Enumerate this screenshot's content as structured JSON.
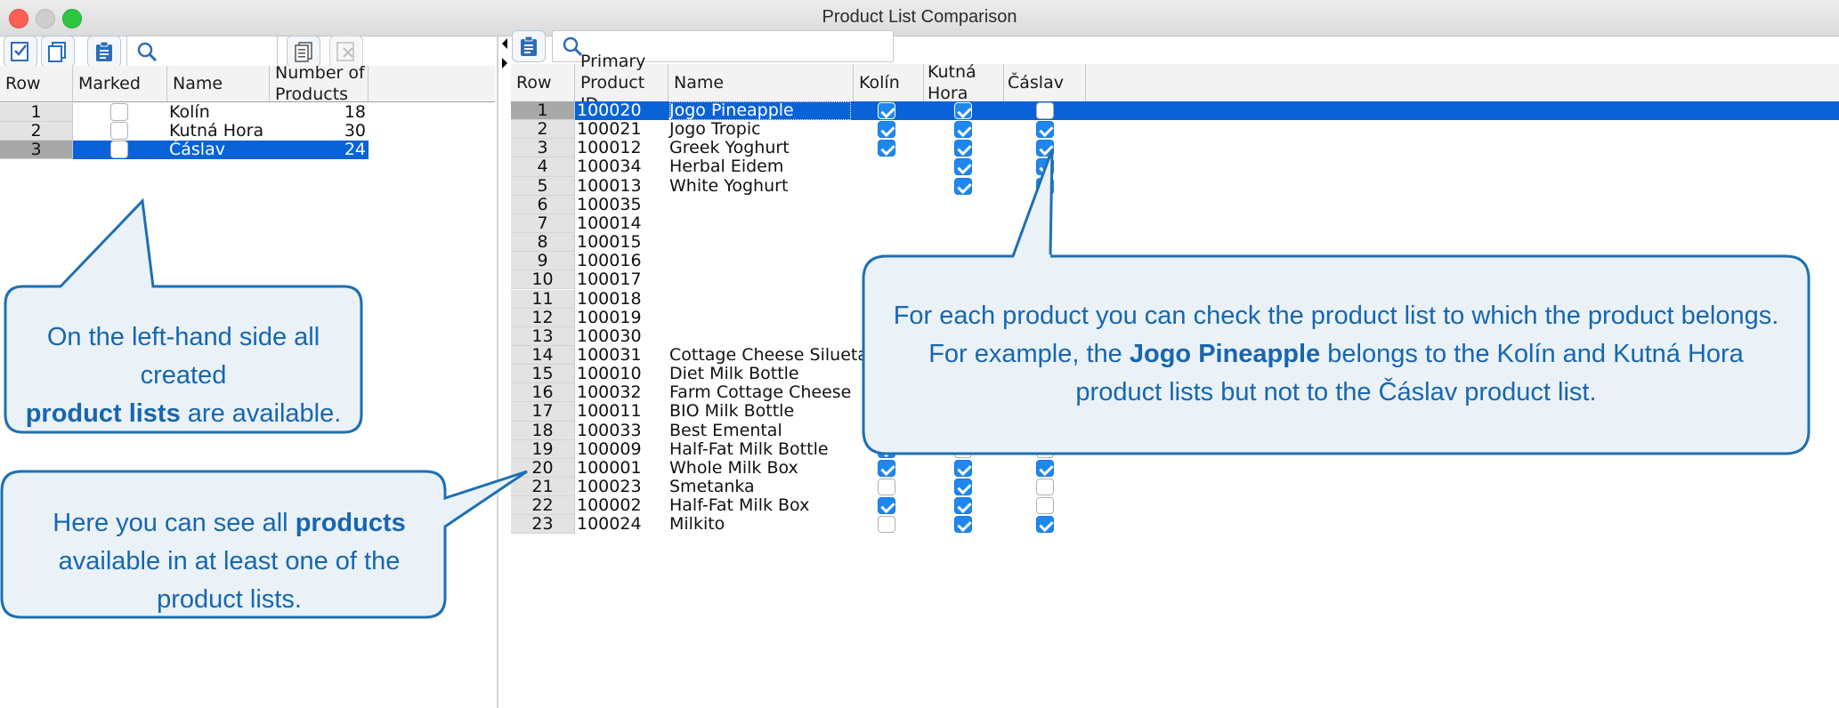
{
  "window": {
    "title": "Product List Comparison"
  },
  "left_panel": {
    "columns": [
      "Row",
      "Marked",
      "Name",
      "Number of Products"
    ],
    "rows": [
      {
        "row": "1",
        "marked": false,
        "name": "Kolín",
        "count": "18",
        "selected": false
      },
      {
        "row": "2",
        "marked": false,
        "name": "Kutná Hora",
        "count": "30",
        "selected": false
      },
      {
        "row": "3",
        "marked": false,
        "name": "Čáslav",
        "count": "24",
        "selected": true
      }
    ]
  },
  "right_panel": {
    "columns": [
      "Row",
      "Primary Product ID",
      "Name",
      "Kolín",
      "Kutná Hora",
      "Čáslav"
    ],
    "rows": [
      {
        "row": "1",
        "id": "100020",
        "name": "Jogo Pineapple",
        "kolin": true,
        "kutna": true,
        "caslav": false,
        "selected": true
      },
      {
        "row": "2",
        "id": "100021",
        "name": "Jogo Tropic",
        "kolin": true,
        "kutna": true,
        "caslav": true
      },
      {
        "row": "3",
        "id": "100012",
        "name": "Greek Yoghurt",
        "kolin": true,
        "kutna": true,
        "caslav": true
      },
      {
        "row": "4",
        "id": "100034",
        "name": "Herbal Eidem",
        "kolin": null,
        "kutna": true,
        "caslav": true
      },
      {
        "row": "5",
        "id": "100013",
        "name": "White Yoghurt",
        "kolin": null,
        "kutna": true,
        "caslav": true
      },
      {
        "row": "6",
        "id": "100035",
        "name": "",
        "kolin": null,
        "kutna": null,
        "caslav": null
      },
      {
        "row": "7",
        "id": "100014",
        "name": "",
        "kolin": null,
        "kutna": null,
        "caslav": null
      },
      {
        "row": "8",
        "id": "100015",
        "name": "",
        "kolin": null,
        "kutna": null,
        "caslav": null
      },
      {
        "row": "9",
        "id": "100016",
        "name": "",
        "kolin": null,
        "kutna": null,
        "caslav": null
      },
      {
        "row": "10",
        "id": "100017",
        "name": "",
        "kolin": null,
        "kutna": null,
        "caslav": null
      },
      {
        "row": "11",
        "id": "100018",
        "name": "",
        "kolin": null,
        "kutna": null,
        "caslav": null
      },
      {
        "row": "12",
        "id": "100019",
        "name": "",
        "kolin": null,
        "kutna": null,
        "caslav": null
      },
      {
        "row": "13",
        "id": "100030",
        "name": "",
        "kolin": null,
        "kutna": null,
        "caslav": null
      },
      {
        "row": "14",
        "id": "100031",
        "name": "Cottage Cheese Silueta",
        "kolin": false,
        "kutna": true,
        "caslav": true
      },
      {
        "row": "15",
        "id": "100010",
        "name": "Diet Milk Bottle",
        "kolin": true,
        "kutna": false,
        "caslav": false
      },
      {
        "row": "16",
        "id": "100032",
        "name": "Farm Cottage Cheese",
        "kolin": false,
        "kutna": true,
        "caslav": true
      },
      {
        "row": "17",
        "id": "100011",
        "name": "BIO Milk Bottle",
        "kolin": true,
        "kutna": false,
        "caslav": false
      },
      {
        "row": "18",
        "id": "100033",
        "name": "Best Emental",
        "kolin": false,
        "kutna": true,
        "caslav": true
      },
      {
        "row": "19",
        "id": "100009",
        "name": "Half-Fat Milk Bottle",
        "kolin": true,
        "kutna": false,
        "caslav": false
      },
      {
        "row": "20",
        "id": "100001",
        "name": "Whole Milk Box",
        "kolin": true,
        "kutna": true,
        "caslav": true
      },
      {
        "row": "21",
        "id": "100023",
        "name": "Smetanka",
        "kolin": false,
        "kutna": true,
        "caslav": false
      },
      {
        "row": "22",
        "id": "100002",
        "name": "Half-Fat Milk Box",
        "kolin": true,
        "kutna": true,
        "caslav": false
      },
      {
        "row": "23",
        "id": "100024",
        "name": "Milkito",
        "kolin": false,
        "kutna": true,
        "caslav": true
      }
    ]
  },
  "callouts": {
    "left_lists": {
      "pre": "On the left-hand side all created",
      "bold": "product lists",
      "post": "are available."
    },
    "products": {
      "pre": "Here you can see all",
      "bold": "products",
      "post": "available in at least one of the product lists."
    },
    "membership": {
      "pre": "For each product you can check the product list to which the product belongs. For example, the",
      "bold": "Jogo Pineapple",
      "post": "belongs to the Kolín and Kutná Hora product lists but not to the Čáslav product list."
    }
  },
  "colors": {
    "selection": "#0a63d6",
    "checkbox_on": "#1e87f0",
    "callout_fill": "#eaf2f7",
    "callout_stroke": "#1e6fb3",
    "callout_text": "#1766b0"
  }
}
